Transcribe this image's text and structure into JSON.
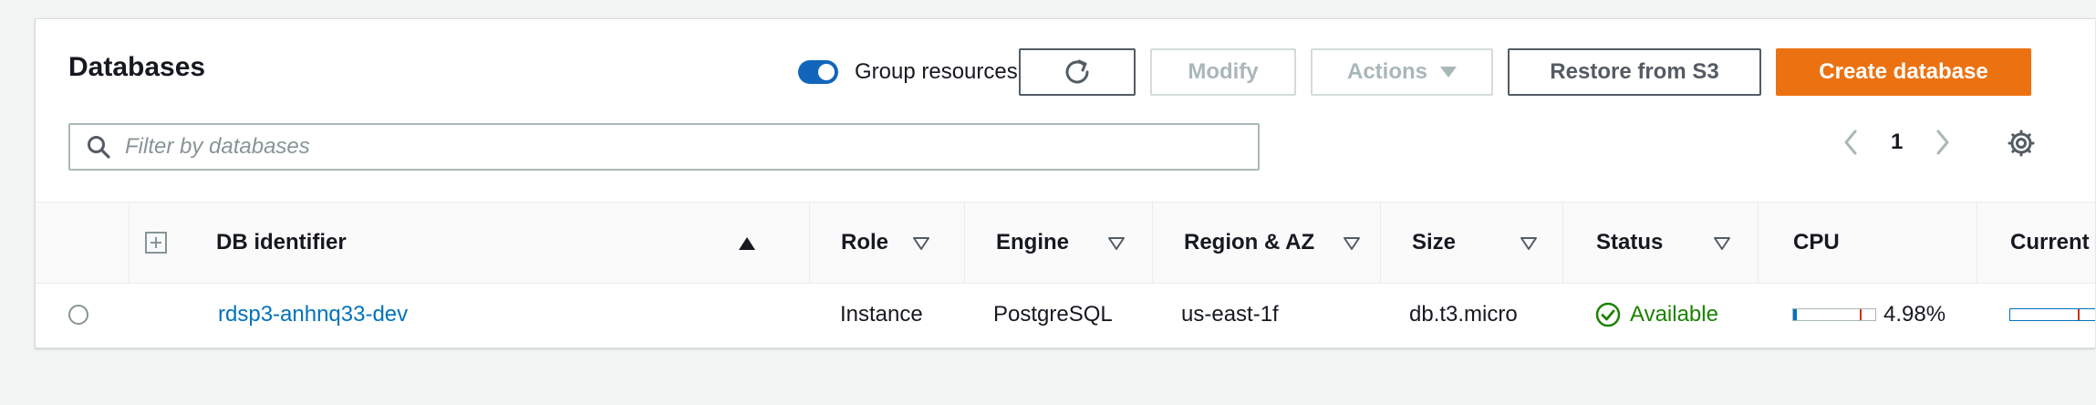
{
  "header": {
    "title": "Databases",
    "toggle_label": "Group resources",
    "toggle_on": true
  },
  "toolbar": {
    "refresh_label": "",
    "modify_label": "Modify",
    "actions_label": "Actions",
    "restore_label": "Restore from S3",
    "create_label": "Create database"
  },
  "filter": {
    "placeholder": "Filter by databases",
    "value": ""
  },
  "pagination": {
    "page": "1"
  },
  "table": {
    "columns": [
      "DB identifier",
      "Role",
      "Engine",
      "Region & AZ",
      "Size",
      "Status",
      "CPU",
      "Current"
    ],
    "rows": [
      {
        "db_identifier": "rdsp3-anhnq33-dev",
        "role": "Instance",
        "engine": "PostgreSQL",
        "region_az": "us-east-1f",
        "size": "db.t3.micro",
        "status": "Available",
        "cpu": "4.98%",
        "cpu_fraction": 0.0498
      }
    ]
  },
  "colors": {
    "primary": "#ec7211",
    "link": "#0073bb",
    "toggle": "#1166bb",
    "status_ok": "#1d8102"
  }
}
